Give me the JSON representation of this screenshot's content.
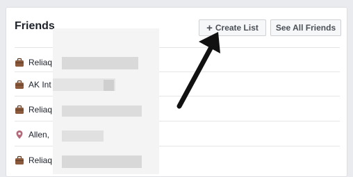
{
  "header": {
    "title": "Friends",
    "create_list_label": "Create List",
    "see_all_label": "See All Friends"
  },
  "friends": [
    {
      "name": "Reliaq",
      "icon": "briefcase-icon"
    },
    {
      "name": "AK Int",
      "icon": "briefcase-icon"
    },
    {
      "name": "Reliaq",
      "icon": "briefcase-icon"
    },
    {
      "name": "Allen,",
      "icon": "location-pin-icon"
    },
    {
      "name": "Reliaq",
      "icon": "briefcase-icon"
    }
  ],
  "colors": {
    "background": "#e9ebee",
    "panel": "#ffffff",
    "button_bg": "#f6f7f9",
    "briefcase": "#8b5a3c",
    "pin": "#b3697a"
  }
}
